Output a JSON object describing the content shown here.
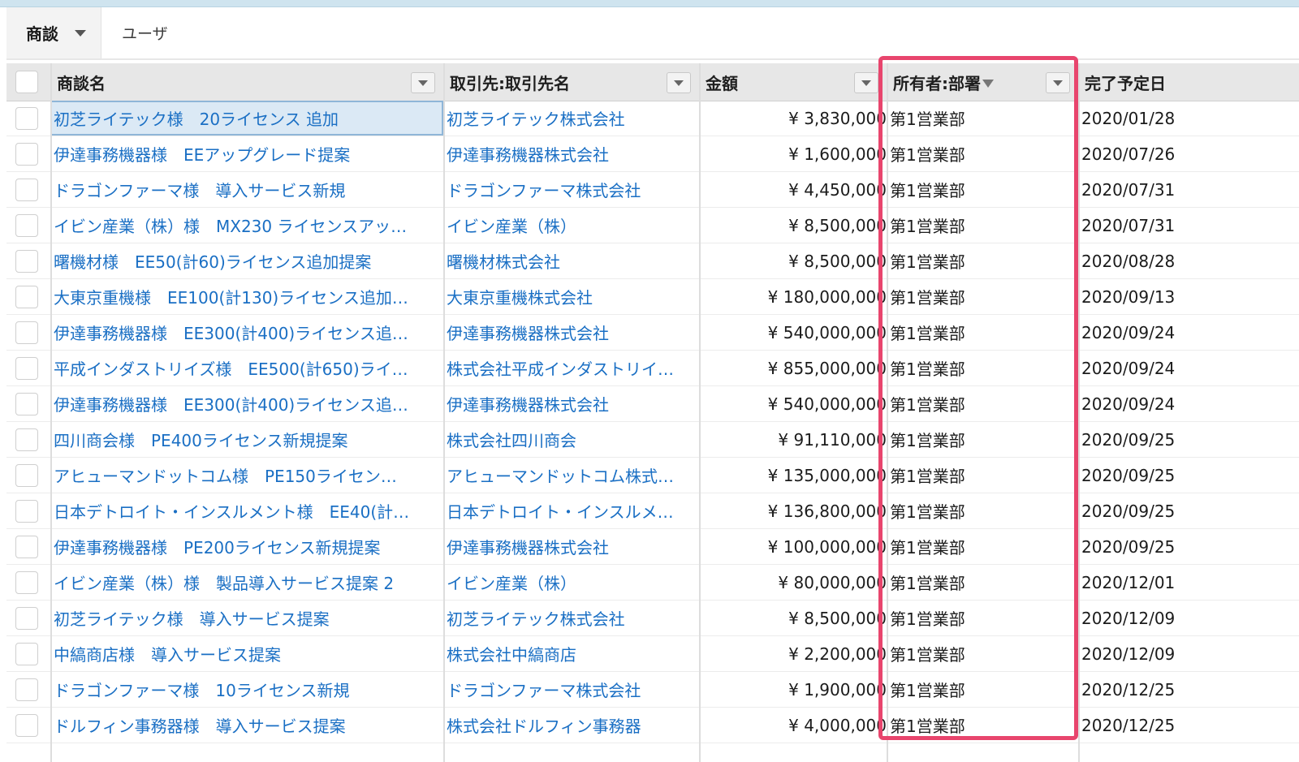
{
  "tabs": {
    "active_label": "商談",
    "other_label": "ユーザ"
  },
  "columns": {
    "name": "商談名",
    "account": "取引先:取引先名",
    "amount": "金額",
    "owner_dept": "所有者:部署",
    "close_date": "完了予定日"
  },
  "rows": [
    {
      "name": "初芝ライテック様　20ライセンス 追加",
      "account": "初芝ライテック株式会社",
      "amount": "¥ 3,830,000",
      "dept": "第1営業部",
      "date": "2020/01/28"
    },
    {
      "name": "伊達事務機器様　EEアップグレード提案",
      "account": "伊達事務機器株式会社",
      "amount": "¥ 1,600,000",
      "dept": "第1営業部",
      "date": "2020/07/26"
    },
    {
      "name": "ドラゴンファーマ様　導入サービス新規",
      "account": "ドラゴンファーマ株式会社",
      "amount": "¥ 4,450,000",
      "dept": "第1営業部",
      "date": "2020/07/31"
    },
    {
      "name": "イビン産業（株）様　MX230 ライセンスアッ…",
      "account": "イビン産業（株）",
      "amount": "¥ 8,500,000",
      "dept": "第1営業部",
      "date": "2020/07/31"
    },
    {
      "name": "曙機材様　EE50(計60)ライセンス追加提案",
      "account": "曙機材株式会社",
      "amount": "¥ 8,500,000",
      "dept": "第1営業部",
      "date": "2020/08/28"
    },
    {
      "name": "大東京重機様　EE100(計130)ライセンス追加…",
      "account": "大東京重機株式会社",
      "amount": "¥ 180,000,000",
      "dept": "第1営業部",
      "date": "2020/09/13"
    },
    {
      "name": "伊達事務機器様　EE300(計400)ライセンス追…",
      "account": "伊達事務機器株式会社",
      "amount": "¥ 540,000,000",
      "dept": "第1営業部",
      "date": "2020/09/24"
    },
    {
      "name": "平成インダストリイズ様　EE500(計650)ライ…",
      "account": "株式会社平成インダストリイ…",
      "amount": "¥ 855,000,000",
      "dept": "第1営業部",
      "date": "2020/09/24"
    },
    {
      "name": "伊達事務機器様　EE300(計400)ライセンス追…",
      "account": "伊達事務機器株式会社",
      "amount": "¥ 540,000,000",
      "dept": "第1営業部",
      "date": "2020/09/24"
    },
    {
      "name": "四川商会様　PE400ライセンス新規提案",
      "account": "株式会社四川商会",
      "amount": "¥ 91,110,000",
      "dept": "第1営業部",
      "date": "2020/09/25"
    },
    {
      "name": "アヒューマンドットコム様　PE150ライセン…",
      "account": "アヒューマンドットコム株式…",
      "amount": "¥ 135,000,000",
      "dept": "第1営業部",
      "date": "2020/09/25"
    },
    {
      "name": "日本デトロイト・インスルメント様　EE40(計…",
      "account": "日本デトロイト・インスルメ…",
      "amount": "¥ 136,800,000",
      "dept": "第1営業部",
      "date": "2020/09/25"
    },
    {
      "name": "伊達事務機器様　PE200ライセンス新規提案",
      "account": "伊達事務機器株式会社",
      "amount": "¥ 100,000,000",
      "dept": "第1営業部",
      "date": "2020/09/25"
    },
    {
      "name": "イビン産業（株）様　製品導入サービス提案 2",
      "account": "イビン産業（株）",
      "amount": "¥ 80,000,000",
      "dept": "第1営業部",
      "date": "2020/12/01"
    },
    {
      "name": "初芝ライテック様　導入サービス提案",
      "account": "初芝ライテック株式会社",
      "amount": "¥ 8,500,000",
      "dept": "第1営業部",
      "date": "2020/12/09"
    },
    {
      "name": "中縞商店様　導入サービス提案",
      "account": "株式会社中縞商店",
      "amount": "¥ 2,200,000",
      "dept": "第1営業部",
      "date": "2020/12/09"
    },
    {
      "name": "ドラゴンファーマ様　10ライセンス新規",
      "account": "ドラゴンファーマ株式会社",
      "amount": "¥ 1,900,000",
      "dept": "第1営業部",
      "date": "2020/12/25"
    },
    {
      "name": "ドルフィン事務器様　導入サービス提案",
      "account": "株式会社ドルフィン事務器",
      "amount": "¥ 4,000,000",
      "dept": "第1営業部",
      "date": "2020/12/25"
    }
  ],
  "colors": {
    "link": "#1a6fc4",
    "highlight": "#e8456d",
    "header_bg": "#e7e7e7"
  },
  "icons": {
    "tab_dropdown": "chevron-down-icon",
    "column_menu": "chevron-down-icon",
    "filter": "filter-icon"
  }
}
